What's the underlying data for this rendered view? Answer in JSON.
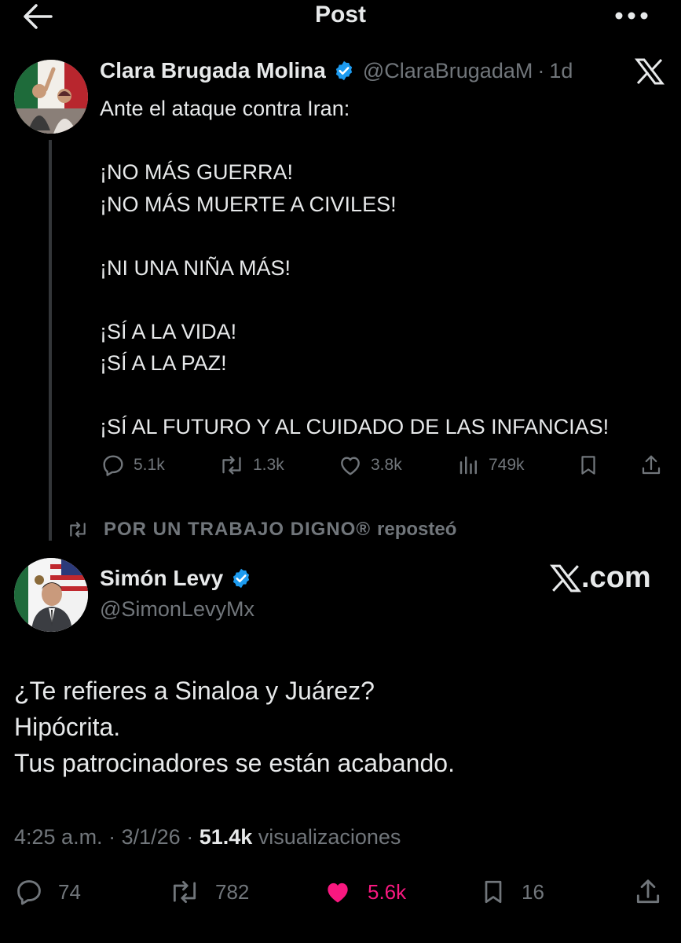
{
  "header": {
    "title": "Post"
  },
  "quoted_post": {
    "author_name": "Clara Brugada Molina",
    "handle": "@ClaraBrugadaM",
    "separator": "·",
    "time": "1d",
    "text": "Ante el ataque contra Iran:\n\n¡NO MÁS GUERRA!\n¡NO MÁS MUERTE A CIVILES!\n\n¡NI UNA NIÑA MÁS!\n\n¡SÍ A LA VIDA!\n¡SÍ A LA PAZ!\n\n¡SÍ AL FUTURO Y AL CUIDADO DE LAS INFANCIAS!",
    "replies": "5.1k",
    "reposts": "1.3k",
    "likes": "3.8k",
    "views": "749k"
  },
  "repost_banner": {
    "reposter": "POR UN TRABAJO DIGNO®",
    "verb": "reposteó"
  },
  "main_post": {
    "author_name": "Simón Levy",
    "handle": "@SimonLevyMx",
    "watermark_text": ".com",
    "text": "¿Te refieres a Sinaloa y Juárez?\nHipócrita.\nTus patrocinadores se están acabando.",
    "time": "4:25 a.m.",
    "date": "3/1/26",
    "views_count": "51.4k",
    "views_label": "visualizaciones",
    "dot": "·",
    "replies": "74",
    "reposts": "782",
    "likes": "5.6k",
    "bookmarks": "16"
  },
  "colors": {
    "background": "#000000",
    "text": "#e7e9ea",
    "muted": "#71767b",
    "verified": "#1d9bf0",
    "like": "#f91880"
  },
  "icons": [
    "back-arrow-icon",
    "more-icon",
    "verified-icon",
    "x-logo-icon",
    "reply-icon",
    "repost-icon",
    "like-icon",
    "views-icon",
    "bookmark-icon",
    "share-icon"
  ]
}
